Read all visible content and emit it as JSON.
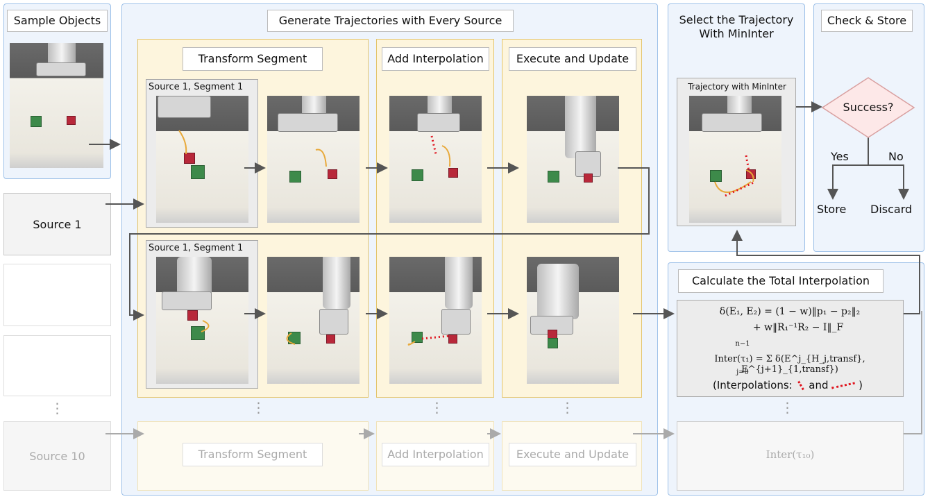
{
  "sample_objects": {
    "title": "Sample Objects"
  },
  "generate": {
    "title": "Generate Trajectories with Every Source"
  },
  "stages": {
    "transform": "Transform Segment",
    "interp": "Add Interpolation",
    "execute": "Execute and Update"
  },
  "segment_label_1": "Source 1, Segment 1",
  "segment_label_2": "Source 1, Segment 1",
  "sources": {
    "s1": "Source 1",
    "s10": "Source 10"
  },
  "select": {
    "title": "Select the Trajectory With MinInter",
    "inner": "Trajectory with MinInter"
  },
  "check": {
    "title": "Check & Store",
    "decision": "Success?",
    "yes": "Yes",
    "no": "No",
    "store": "Store",
    "discard": "Discard"
  },
  "calc": {
    "title": "Calculate the Total Interpolation",
    "eq1": "δ(E₁, E₂) = (1 − w)‖p₁ − p₂‖₂",
    "eq2": "+ w‖R₁⁻¹R₂ − I‖_F",
    "eq3": "Inter(τ₁) = Σ δ(E^j_{H_j,transf}, E^{j+1}_{1,transf})",
    "eq3_sum_top": "n−1",
    "eq3_sum_bottom": "j=0",
    "legend_prefix": "(Interpolations:",
    "legend_mid": "and",
    "legend_suffix": ")",
    "inter10": "Inter(τ₁₀)"
  },
  "ellipsis": "⋮",
  "colors": {
    "blue_panel": "#eef4fc",
    "yellow_panel": "#fdf5dd",
    "interp_dots": "#e0141e",
    "path": "#e8a93a"
  }
}
